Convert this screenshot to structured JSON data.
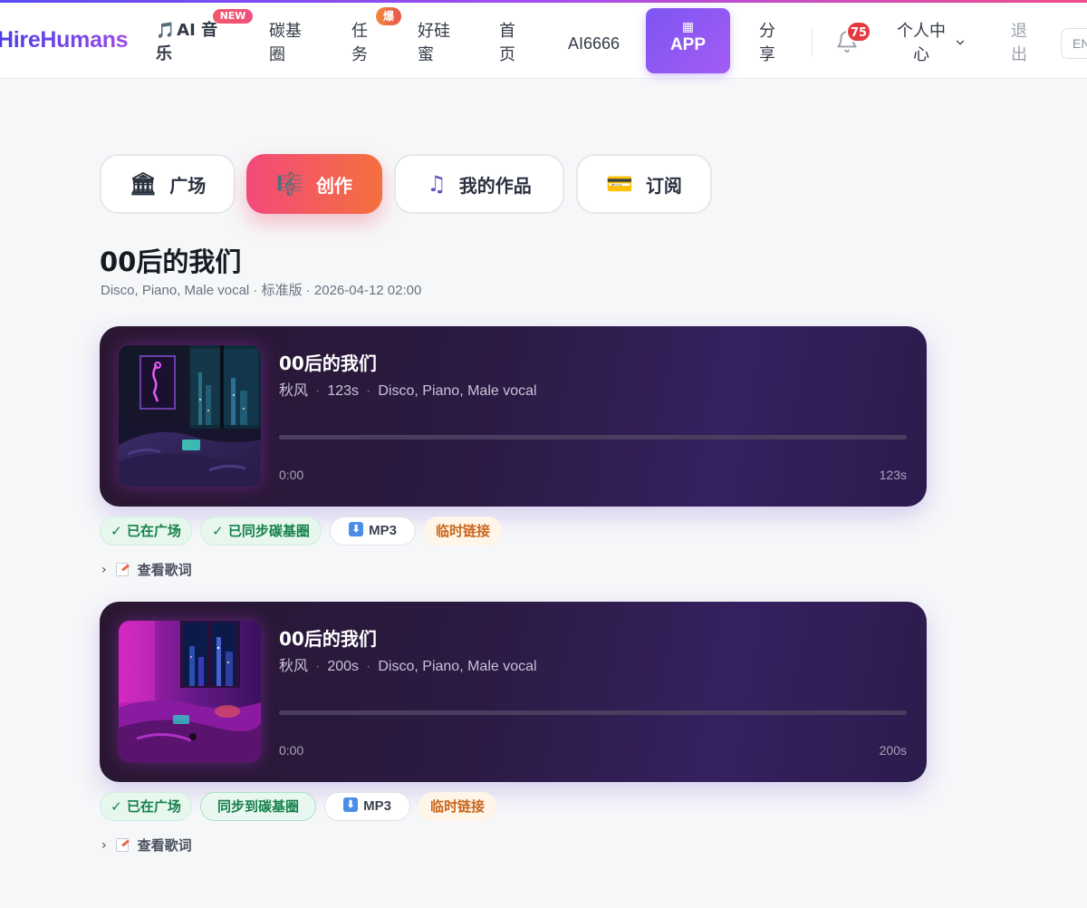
{
  "nav": {
    "brand": "HireHumans",
    "ai_music": "AI 音乐",
    "ai_music_badge": "NEW",
    "carbon_circle": "碳基圈",
    "task": "任务",
    "task_badge": "爆",
    "good_pal": "好硅蜜",
    "home": "首页",
    "ai6666": "AI6666",
    "app_button": "APP",
    "share": "分享",
    "notification_count": "75",
    "personal_center": "个人中心",
    "logout": "退出",
    "language": "EN"
  },
  "tabs": [
    {
      "label": "广场",
      "icon": "bank-icon"
    },
    {
      "label": "创作",
      "icon": "music-score-icon"
    },
    {
      "label": "我的作品",
      "icon": "music-note-icon"
    },
    {
      "label": "订阅",
      "icon": "credit-card-icon"
    }
  ],
  "song": {
    "title": "00后的我们",
    "meta": "Disco, Piano, Male vocal · 标准版 · 2026-04-12 02:00"
  },
  "tracks": [
    {
      "title": "00后的我们",
      "artist": "秋风",
      "duration": "123s",
      "style": "Disco, Piano, Male vocal",
      "current_time": "0:00",
      "total_time": "123s",
      "progress": 0,
      "tags": {
        "plaza": "✓ 已在广场",
        "carbon": "✓ 已同步碳基圈",
        "mp3": "MP3",
        "temp_link": "临时链接"
      },
      "lyrics_toggle": "查看歌词"
    },
    {
      "title": "00后的我们",
      "artist": "秋风",
      "duration": "200s",
      "style": "Disco, Piano, Male vocal",
      "current_time": "0:00",
      "total_time": "200s",
      "progress": 0,
      "tags": {
        "plaza": "✓ 已在广场",
        "carbon": "同步到碳基圈",
        "mp3": "MP3",
        "temp_link": "临时链接"
      },
      "lyrics_toggle": "查看歌词"
    }
  ],
  "colors": {
    "accent_purple": "#7d55f2",
    "create_tab_start": "#f24a7a",
    "create_tab_end": "#f5703e",
    "player_bg": "#2b1a42"
  }
}
